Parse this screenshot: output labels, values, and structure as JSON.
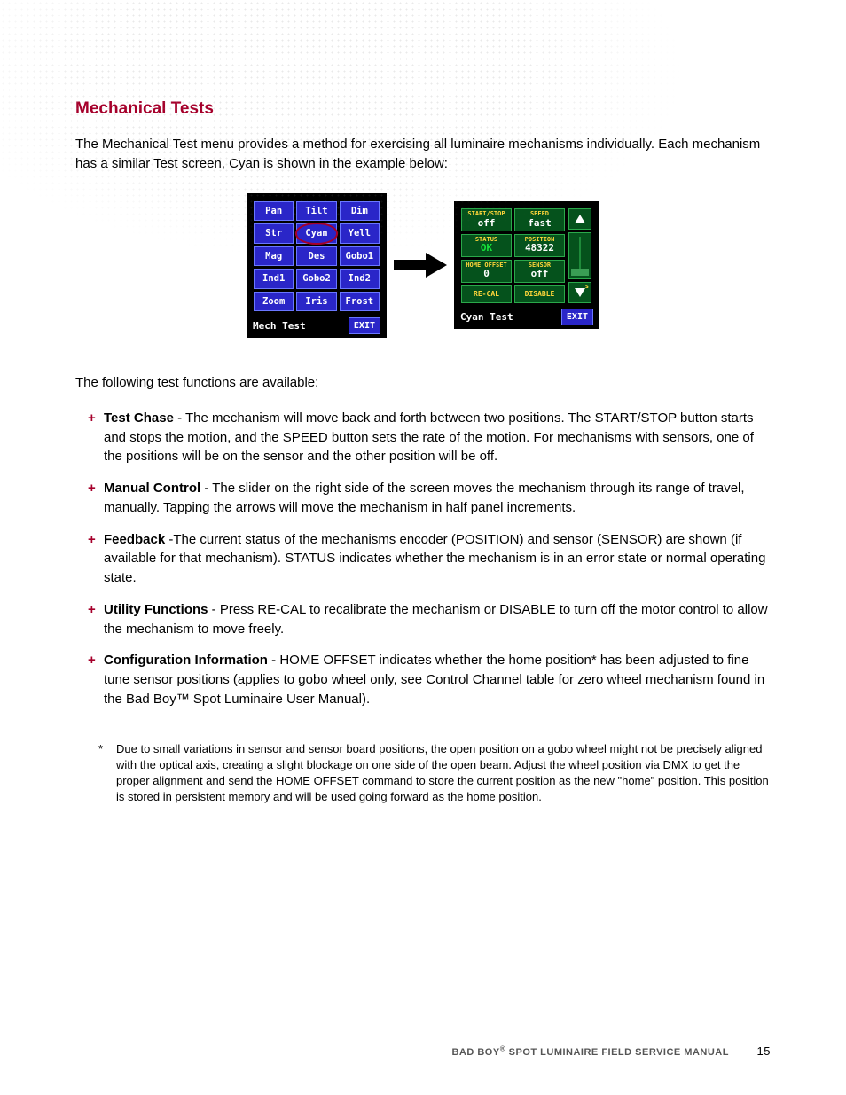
{
  "heading": "Mechanical Tests",
  "intro": "The Mechanical Test menu provides a method for exercising all luminaire mechanisms individually. Each mechanism has a similar Test screen, Cyan is shown in the example below:",
  "leftScreen": {
    "title": "Mech Test",
    "exit": "EXIT",
    "grid": [
      [
        "Pan",
        "Tilt",
        "Dim"
      ],
      [
        "Str",
        "Cyan",
        "Yell"
      ],
      [
        "Mag",
        "Des",
        "Gobo1"
      ],
      [
        "Ind1",
        "Gobo2",
        "Ind2"
      ],
      [
        "Zoom",
        "Iris",
        "Frost"
      ]
    ]
  },
  "rightScreen": {
    "title": "Cyan Test",
    "exit": "EXIT",
    "sliderMark": "s",
    "cells": {
      "startStop": {
        "label": "START/STOP",
        "value": "off"
      },
      "speed": {
        "label": "SPEED",
        "value": "fast"
      },
      "status": {
        "label": "STATUS",
        "value": "OK"
      },
      "position": {
        "label": "POSITION",
        "value": "48322"
      },
      "homeOffset": {
        "label": "HOME OFFSET",
        "value": "0"
      },
      "sensor": {
        "label": "SENSOR",
        "value": "off"
      },
      "recal": {
        "label": "RE-CAL"
      },
      "disable": {
        "label": "DISABLE"
      }
    }
  },
  "availLead": "The following test functions are available:",
  "functions": [
    {
      "name": "Test Chase",
      "text": " - The mechanism will move back and forth between two positions. The START/STOP button starts and stops the motion, and the SPEED button sets the rate of the motion. For mechanisms with sensors, one of the positions will be on the sensor and the other position will be off."
    },
    {
      "name": "Manual Control",
      "text": " - The slider on the right side of the screen moves the mechanism through its range of travel, manually. Tapping the arrows will move the mechanism in half panel increments."
    },
    {
      "name": "Feedback",
      "text": " -The current status of the mechanisms encoder (POSITION) and sensor (SENSOR) are shown (if available for that mechanism). STATUS indicates whether the mechanism is in an error state or normal operating state."
    },
    {
      "name": "Utility Functions",
      "text": " - Press RE-CAL to recalibrate the mechanism or DISABLE to turn off the motor control to allow the mechanism to move freely."
    },
    {
      "name": "Configuration Information",
      "text": " - HOME OFFSET indicates whether the home position* has been adjusted to fine tune sensor positions (applies to gobo wheel only, see Control Channel table for zero wheel mechanism found in the Bad Boy™ Spot Luminaire User Manual)."
    }
  ],
  "footnote": {
    "marker": "*",
    "text": "Due to small variations in sensor and sensor board positions, the open position on a gobo wheel might not be precisely aligned with the optical axis, creating a slight blockage on one side of the open beam. Adjust the wheel position via DMX to get the proper alignment and send the HOME OFFSET command to store the current position as the new \"home\" position. This position is stored in persistent memory and will be used going forward as the home position."
  },
  "footer": {
    "brand": "BAD BOY",
    "reg": "®",
    "rest": "SPOT LUMINAIRE FIELD SERVICE MANUAL",
    "page": "15"
  }
}
